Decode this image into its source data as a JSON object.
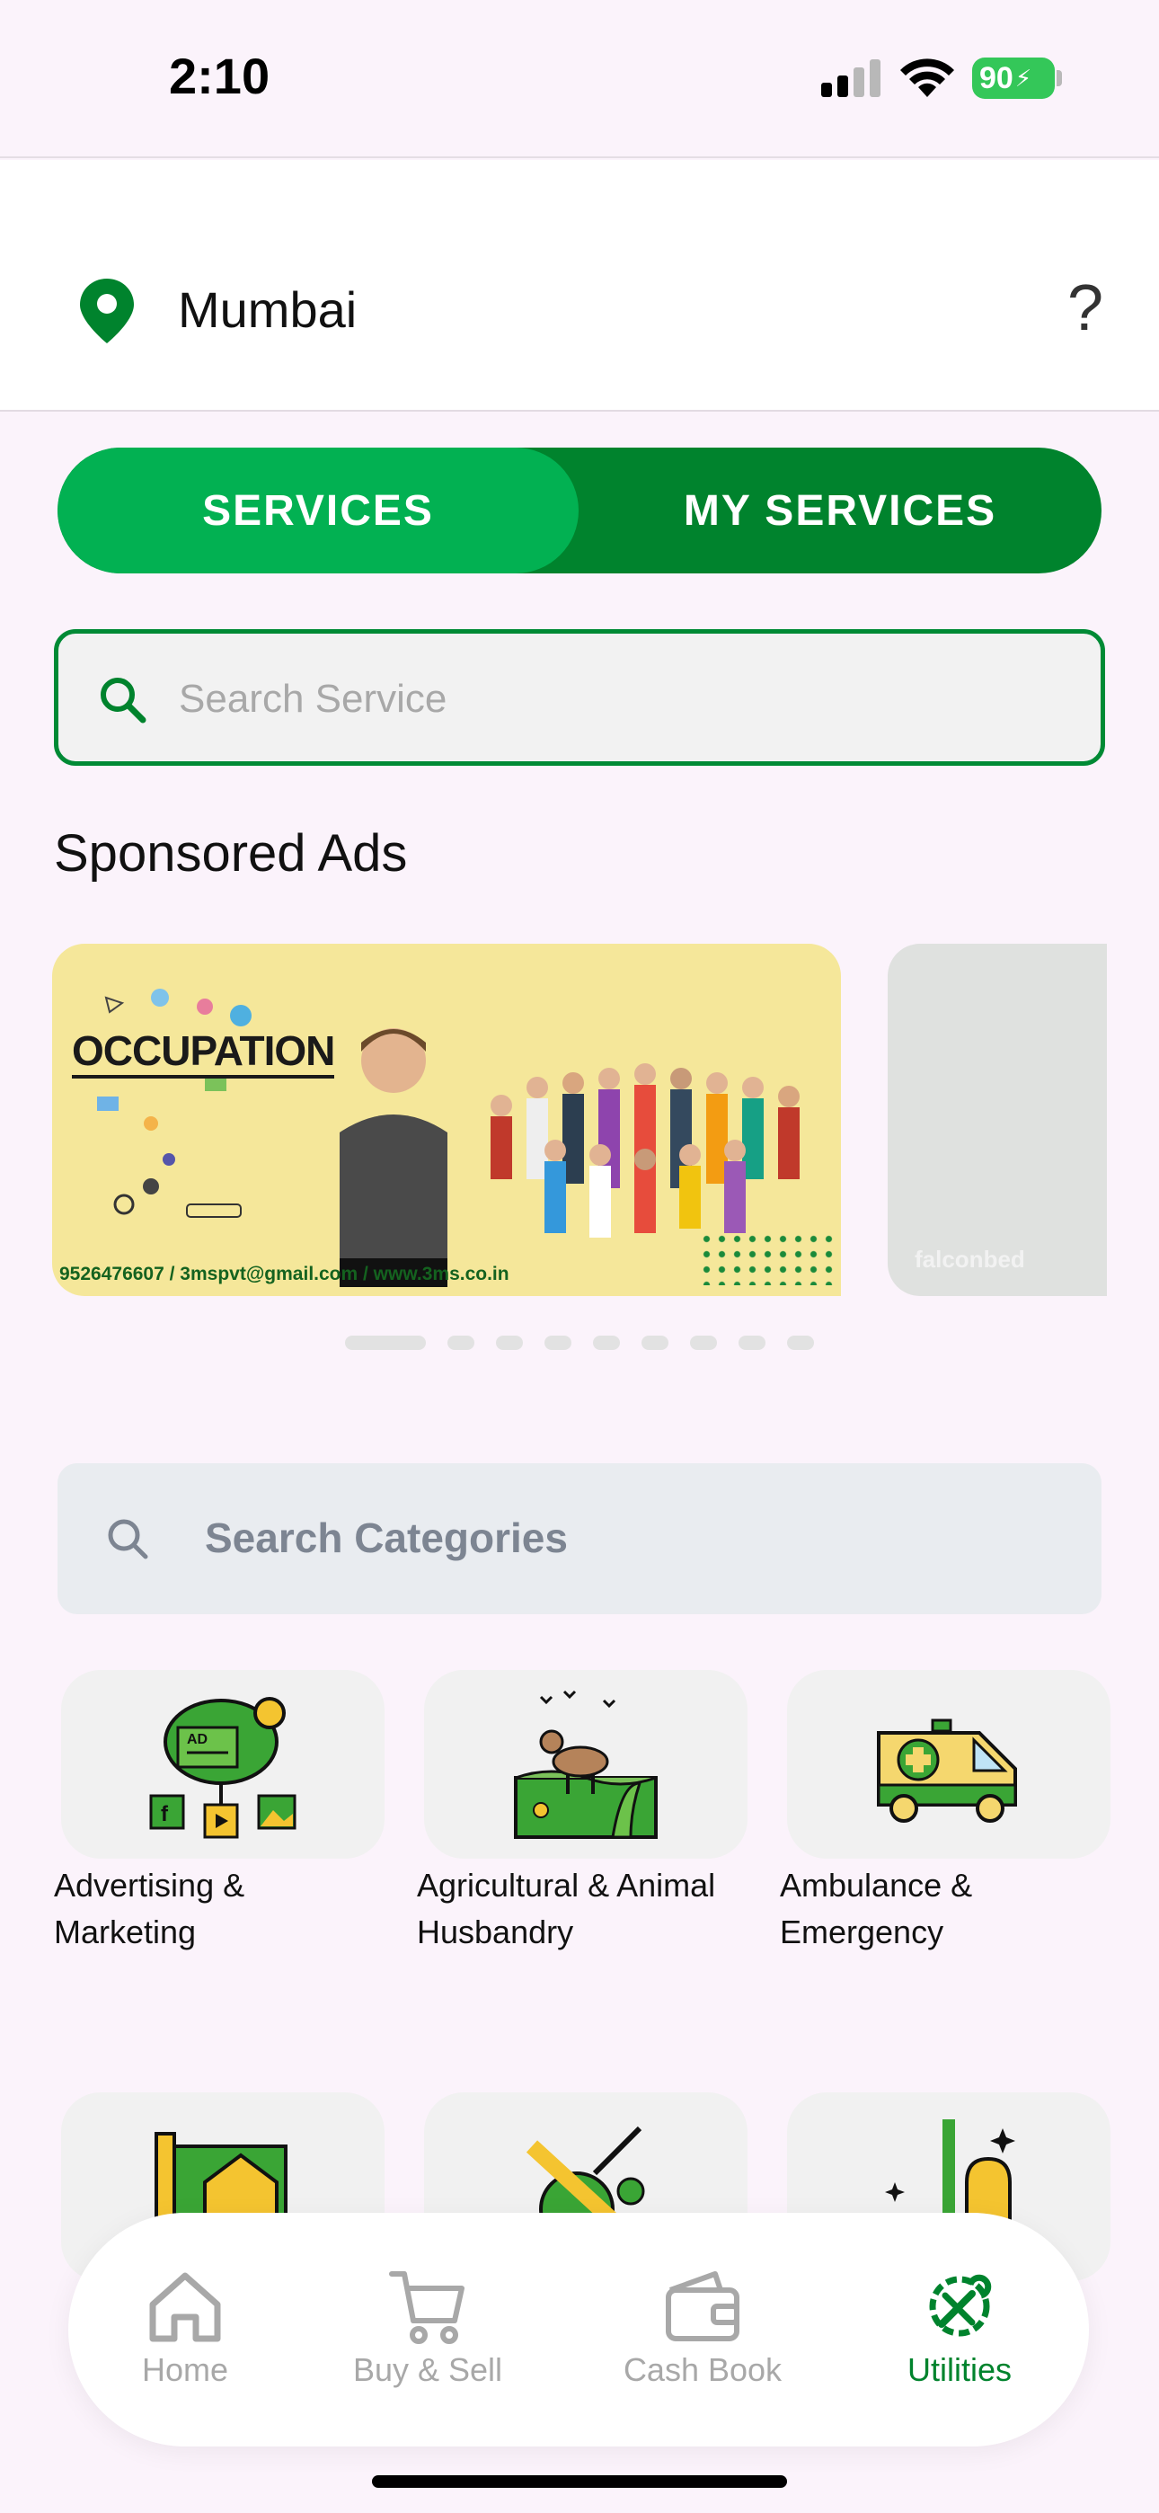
{
  "status_bar": {
    "time": "2:10",
    "battery": "90"
  },
  "location": {
    "city": "Mumbai",
    "help": "?"
  },
  "tabs": {
    "services": "SERVICES",
    "my_services": "MY SERVICES",
    "active": "services"
  },
  "search_service": {
    "placeholder": "Search Service"
  },
  "sponsored": {
    "title": "Sponsored Ads",
    "ads": [
      {
        "headline": "OCCUPATION",
        "contact": "9526476607 / 3mspvt@gmail.com / www.3ms.co.in"
      },
      {
        "brand": "falconbed"
      }
    ],
    "active_index": 0,
    "count": 10
  },
  "category_search": {
    "placeholder": "Search Categories"
  },
  "categories": [
    {
      "label": "Advertising & Marketing",
      "label_line1": "Advertising &",
      "label_line2": "Marketing",
      "icon": "advertising-tree-icon"
    },
    {
      "label": "Agricultural & Animal Husbandry",
      "label_line1": "Agricultural & Animal",
      "label_line2": "Husbandry",
      "icon": "goat-field-icon"
    },
    {
      "label": "Ambulance & Emergency",
      "label_line1": "Ambulance &",
      "label_line2": "Emergency",
      "icon": "ambulance-icon"
    },
    {
      "label": "",
      "icon": "architecture-house-icon"
    },
    {
      "label": "",
      "icon": "sports-icon"
    },
    {
      "label": "",
      "icon": "cleaning-icon"
    }
  ],
  "bottom_nav": [
    {
      "label": "Home",
      "icon": "home-icon"
    },
    {
      "label": "Buy & Sell",
      "icon": "cart-icon"
    },
    {
      "label": "Cash Book",
      "icon": "wallet-icon"
    },
    {
      "label": "Utilities",
      "icon": "tools-icon",
      "active": true
    }
  ],
  "colors": {
    "primary": "#02b152",
    "primary_dark": "#00832d",
    "background": "#fbf3fb"
  }
}
